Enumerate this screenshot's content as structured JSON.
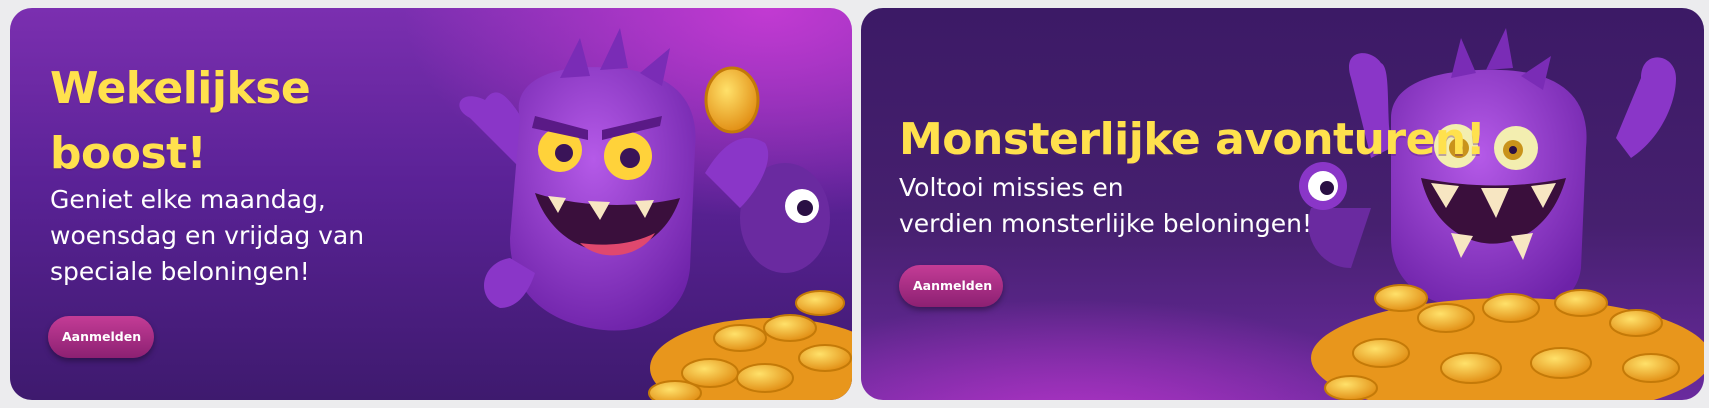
{
  "promos": [
    {
      "title": "Wekelijkse boost!",
      "body": "Geniet elke maandag, woensdag en vrijdag van speciale beloningen!",
      "cta_label": "Aanmelden",
      "illustration": "purple-monster-with-gold-coin"
    },
    {
      "title": "Monsterlijke avonturen!",
      "body_line1": "Voltooi missies en",
      "body_line2": "verdien monsterlijke beloningen!",
      "cta_label": "Aanmelden",
      "illustration": "purple-monster-on-coin-pile"
    }
  ],
  "colors": {
    "title": "#ffe14d",
    "cta": "#b03388",
    "card_bg": "#5a2296",
    "monster": "#9b3fd6",
    "coin": "#f5a623"
  }
}
